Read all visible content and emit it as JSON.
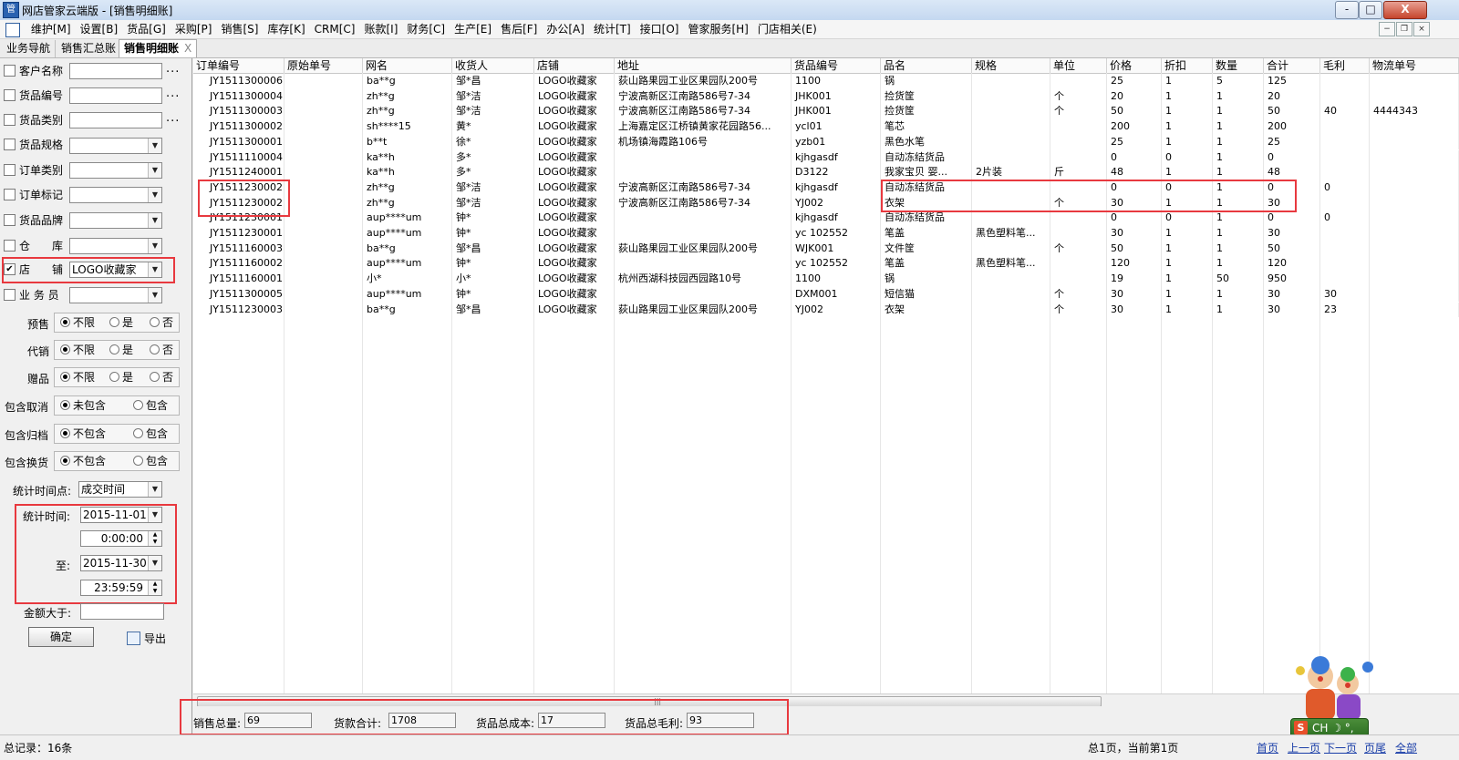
{
  "window": {
    "title": "网店管家云端版 - [销售明细账]",
    "minimize": "-",
    "maximize": "□",
    "close": "X"
  },
  "menu": [
    "维护[M]",
    "设置[B]",
    "货品[G]",
    "采购[P]",
    "销售[S]",
    "库存[K]",
    "CRM[C]",
    "账款[I]",
    "财务[C]",
    "生产[E]",
    "售后[F]",
    "办公[A]",
    "统计[T]",
    "接口[O]",
    "管家服务[H]",
    "门店相关(E)"
  ],
  "mdi_controls": {
    "minimize": "−",
    "restore": "❐",
    "close": "×"
  },
  "tabs": [
    {
      "label": "业务导航"
    },
    {
      "label": "销售汇总账"
    },
    {
      "label": "销售明细账",
      "close": "X"
    }
  ],
  "filters": {
    "customer": {
      "label": "客户名称",
      "value": "",
      "dots": "..."
    },
    "product_code": {
      "label": "货品编号",
      "value": "",
      "dots": "..."
    },
    "product_category": {
      "label": "货品类别",
      "value": "",
      "dots": "..."
    },
    "product_spec": {
      "label": "货品规格",
      "value": ""
    },
    "order_type": {
      "label": "订单类别",
      "value": ""
    },
    "order_mark": {
      "label": "订单标记",
      "value": ""
    },
    "brand": {
      "label": "货品品牌",
      "value": ""
    },
    "warehouse": {
      "label": "仓　　库",
      "value": ""
    },
    "shop": {
      "label": "店　　铺",
      "value": "LOGO收藏家",
      "checked": "✔"
    },
    "salesperson": {
      "label": "业 务 员",
      "value": ""
    },
    "presale": {
      "label": "预售",
      "options": [
        "不限",
        "是",
        "否"
      ],
      "selected": "不限"
    },
    "consignment": {
      "label": "代销",
      "options": [
        "不限",
        "是",
        "否"
      ],
      "selected": "不限"
    },
    "gift": {
      "label": "赠品",
      "options": [
        "不限",
        "是",
        "否"
      ],
      "selected": "不限"
    },
    "include_cancel": {
      "label": "包含取消",
      "options": [
        "未包含",
        "包含"
      ],
      "selected": "未包含"
    },
    "include_return": {
      "label": "包含归档",
      "options": [
        "不包含",
        "包含"
      ],
      "selected": "不包含"
    },
    "include_exchange": {
      "label": "包含换货",
      "options": [
        "不包含",
        "包含"
      ],
      "selected": "不包含"
    },
    "time_basis": {
      "label": "统计时间点:",
      "value": "成交时间"
    },
    "time_from": {
      "label": "统计时间:",
      "date": "2015-11-01",
      "time": "0:00:00"
    },
    "time_to": {
      "label": "至:",
      "date": "2015-11-30",
      "time": "23:59:59"
    },
    "amount_gt": {
      "label": "金额大于:",
      "value": ""
    },
    "confirm": "确定",
    "export": "导出"
  },
  "table": {
    "columns": [
      "订单编号",
      "原始单号",
      "网名",
      "收货人",
      "店铺",
      "地址",
      "货品编号",
      "品名",
      "规格",
      "单位",
      "价格",
      "折扣",
      "数量",
      "合计",
      "毛利",
      "物流单号"
    ],
    "rows": [
      [
        "JY1511300006",
        "",
        "ba**g",
        "邹*昌",
        "LOGO收藏家",
        "荻山路果园工业区果园队200号",
        "1100",
        "锅",
        "",
        "",
        "25",
        "1",
        "5",
        "125",
        "",
        ""
      ],
      [
        "JY1511300004",
        "",
        "zh**g",
        "邹*洁",
        "LOGO收藏家",
        "宁波高新区江南路586号7-34",
        "JHK001",
        "捡货筐",
        "",
        "个",
        "20",
        "1",
        "1",
        "20",
        "",
        ""
      ],
      [
        "JY1511300003",
        "",
        "zh**g",
        "邹*洁",
        "LOGO收藏家",
        "宁波高新区江南路586号7-34",
        "JHK001",
        "捡货筐",
        "",
        "个",
        "50",
        "1",
        "1",
        "50",
        "40",
        "4444343"
      ],
      [
        "JY1511300002",
        "",
        "sh****15",
        "黄*",
        "LOGO收藏家",
        "上海嘉定区江桥镇黄家花园路56...",
        "ycl01",
        "笔芯",
        "",
        "",
        "200",
        "1",
        "1",
        "200",
        "",
        ""
      ],
      [
        "JY1511300001",
        "",
        "b**t",
        "徐*",
        "LOGO收藏家",
        "机场镇海霞路106号",
        "yzb01",
        "黑色水笔",
        "",
        "",
        "25",
        "1",
        "1",
        "25",
        "",
        ""
      ],
      [
        "JY1511110004",
        "",
        "ka**h",
        "多*",
        "LOGO收藏家",
        "",
        "kjhgasdf",
        "自动冻结货品",
        "",
        "",
        "0",
        "0",
        "1",
        "0",
        "",
        ""
      ],
      [
        "JY1511240001",
        "",
        "ka**h",
        "多*",
        "LOGO收藏家",
        "",
        "D3122",
        "我家宝贝 婴...",
        "2片装",
        "斤",
        "48",
        "1",
        "1",
        "48",
        "",
        ""
      ],
      [
        "JY1511230002",
        "",
        "zh**g",
        "邹*洁",
        "LOGO收藏家",
        "宁波高新区江南路586号7-34",
        "kjhgasdf",
        "自动冻结货品",
        "",
        "",
        "0",
        "0",
        "1",
        "0",
        "0",
        ""
      ],
      [
        "JY1511230002",
        "",
        "zh**g",
        "邹*洁",
        "LOGO收藏家",
        "宁波高新区江南路586号7-34",
        "YJ002",
        "衣架",
        "",
        "个",
        "30",
        "1",
        "1",
        "30",
        "",
        ""
      ],
      [
        "JY1511230001",
        "",
        "aup****um",
        "钟*",
        "LOGO收藏家",
        "",
        "kjhgasdf",
        "自动冻结货品",
        "",
        "",
        "0",
        "0",
        "1",
        "0",
        "0",
        ""
      ],
      [
        "JY1511230001",
        "",
        "aup****um",
        "钟*",
        "LOGO收藏家",
        "",
        "yc 102552",
        "笔盖",
        "黑色塑料笔...",
        "",
        "30",
        "1",
        "1",
        "30",
        "",
        ""
      ],
      [
        "JY1511160003",
        "",
        "ba**g",
        "邹*昌",
        "LOGO收藏家",
        "荻山路果园工业区果园队200号",
        "WJK001",
        "文件筐",
        "",
        "个",
        "50",
        "1",
        "1",
        "50",
        "",
        ""
      ],
      [
        "JY1511160002",
        "",
        "aup****um",
        "钟*",
        "LOGO收藏家",
        "",
        "yc 102552",
        "笔盖",
        "黑色塑料笔...",
        "",
        "120",
        "1",
        "1",
        "120",
        "",
        ""
      ],
      [
        "JY1511160001",
        "",
        "小*",
        "小*",
        "LOGO收藏家",
        "杭州西湖科技园西园路10号",
        "1100",
        "锅",
        "",
        "",
        "19",
        "1",
        "50",
        "950",
        "",
        ""
      ],
      [
        "JY1511300005",
        "",
        "aup****um",
        "钟*",
        "LOGO收藏家",
        "",
        "DXM001",
        "短信猫",
        "",
        "个",
        "30",
        "1",
        "1",
        "30",
        "30",
        ""
      ],
      [
        "JY1511230003",
        "",
        "ba**g",
        "邹*昌",
        "LOGO收藏家",
        "荻山路果园工业区果园队200号",
        "YJ002",
        "衣架",
        "",
        "个",
        "30",
        "1",
        "1",
        "30",
        "23",
        ""
      ]
    ]
  },
  "scrollbar": {
    "grip": "|||"
  },
  "summary": {
    "total_qty": {
      "label": "销售总量:",
      "value": "69"
    },
    "total_amount": {
      "label": "货款合计:",
      "value": "1708"
    },
    "total_cost": {
      "label": "货品总成本:",
      "value": "17"
    },
    "total_profit": {
      "label": "货品总毛利:",
      "value": "93"
    }
  },
  "status": {
    "records": "总记录：16条",
    "pages": "总1页，当前第1页",
    "first": "首页",
    "prev": "上一页",
    "next": "下一页",
    "last": "页尾",
    "all": "全部"
  },
  "ime": {
    "s": "S",
    "text": "CH ☽ °, 简"
  }
}
